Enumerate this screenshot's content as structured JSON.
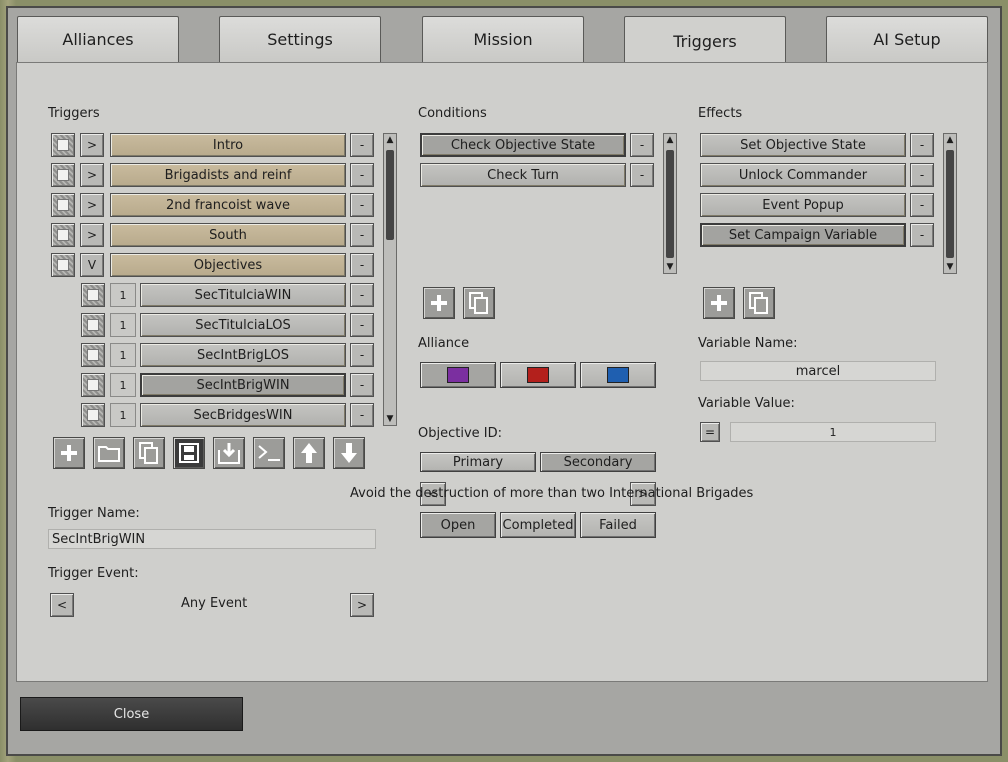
{
  "tabs": [
    "Alliances",
    "Settings",
    "Mission",
    "Triggers",
    "AI Setup"
  ],
  "active_tab": "Triggers",
  "triggers": {
    "label": "Triggers",
    "groups": [
      {
        "arrow": ">",
        "name": "Intro"
      },
      {
        "arrow": ">",
        "name": "Brigadists and reinf"
      },
      {
        "arrow": ">",
        "name": "2nd francoist wave"
      },
      {
        "arrow": ">",
        "name": "South"
      },
      {
        "arrow": "V",
        "name": "Objectives"
      }
    ],
    "children": [
      {
        "num": "1",
        "name": "SecTitulciaWIN"
      },
      {
        "num": "1",
        "name": "SecTitulciaLOS"
      },
      {
        "num": "1",
        "name": "SecIntBrigLOS"
      },
      {
        "num": "1",
        "name": "SecIntBrigWIN"
      },
      {
        "num": "1",
        "name": "SecBridgesWIN"
      }
    ],
    "remove_label": "-",
    "toolbar": [
      "add-icon",
      "folder-icon",
      "copy-icon",
      "save-icon",
      "import-icon",
      "console-icon",
      "arrow-up-icon",
      "arrow-down-icon"
    ]
  },
  "conditions": {
    "label": "Conditions",
    "items": [
      "Check Objective State",
      "Check Turn"
    ],
    "remove_label": "-",
    "alliance_label": "Alliance",
    "alliance_colors": [
      "#7b2fa0",
      "#b3201c",
      "#1f5fb0"
    ],
    "objective_id_label": "Objective ID:",
    "objective_types": [
      "Primary",
      "Secondary"
    ],
    "objective_nav_prev": "<",
    "objective_nav_next": ">",
    "objective_desc": "Avoid the destruction of more than two International Brigades",
    "states": [
      "Open",
      "Completed",
      "Failed"
    ]
  },
  "effects": {
    "label": "Effects",
    "items": [
      "Set Objective State",
      "Unlock Commander",
      "Event Popup",
      "Set Campaign Variable"
    ],
    "remove_label": "-",
    "variable_name_label": "Variable Name:",
    "variable_name": "marcel",
    "variable_value_label": "Variable Value:",
    "operator": "=",
    "variable_value": "1"
  },
  "trigger_name_label": "Trigger Name:",
  "trigger_name": "SecIntBrigWIN",
  "trigger_event_label": "Trigger Event:",
  "trigger_event_prev": "<",
  "trigger_event": "Any Event",
  "trigger_event_next": ">",
  "close_label": "Close"
}
